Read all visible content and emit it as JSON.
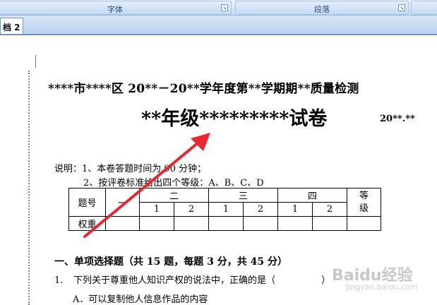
{
  "ribbon": {
    "groups": [
      {
        "label": "字体"
      },
      {
        "label": "段落"
      }
    ]
  },
  "tabs": {
    "active_label": "档 2"
  },
  "document": {
    "title": "****市****区 20**－20**学年度第**学期期**质量检测",
    "subtitle": "**年级*********试卷",
    "score_label": "20**.**",
    "note_line1": "说明：1、本卷答题时间为 90 分钟；",
    "note_line2": "2、按评卷标准给出四个等级：A、B、C、D",
    "table": {
      "header_num": "题号",
      "col_one": "一",
      "col_two": "二",
      "col_three": "三",
      "col_four": "四",
      "col_grade": "等级",
      "sub": [
        "1",
        "2",
        "1",
        "2",
        "1",
        "2"
      ],
      "weight_label": "权重"
    },
    "section_heading": "一、单项选择题（共 15 题，每题 3 分，共 45 分）",
    "question1_number": "1.",
    "question1_text": "下列关于尊重他人知识产权的说法中，正确的是（　　　　　）",
    "question1_option_a": "A．可以复制他人信息作品的内容"
  },
  "annotation": {
    "arrow_color": "#e8262d"
  },
  "watermark": {
    "text": "Baidu经验",
    "sub": "jingyan.baidu.com"
  }
}
